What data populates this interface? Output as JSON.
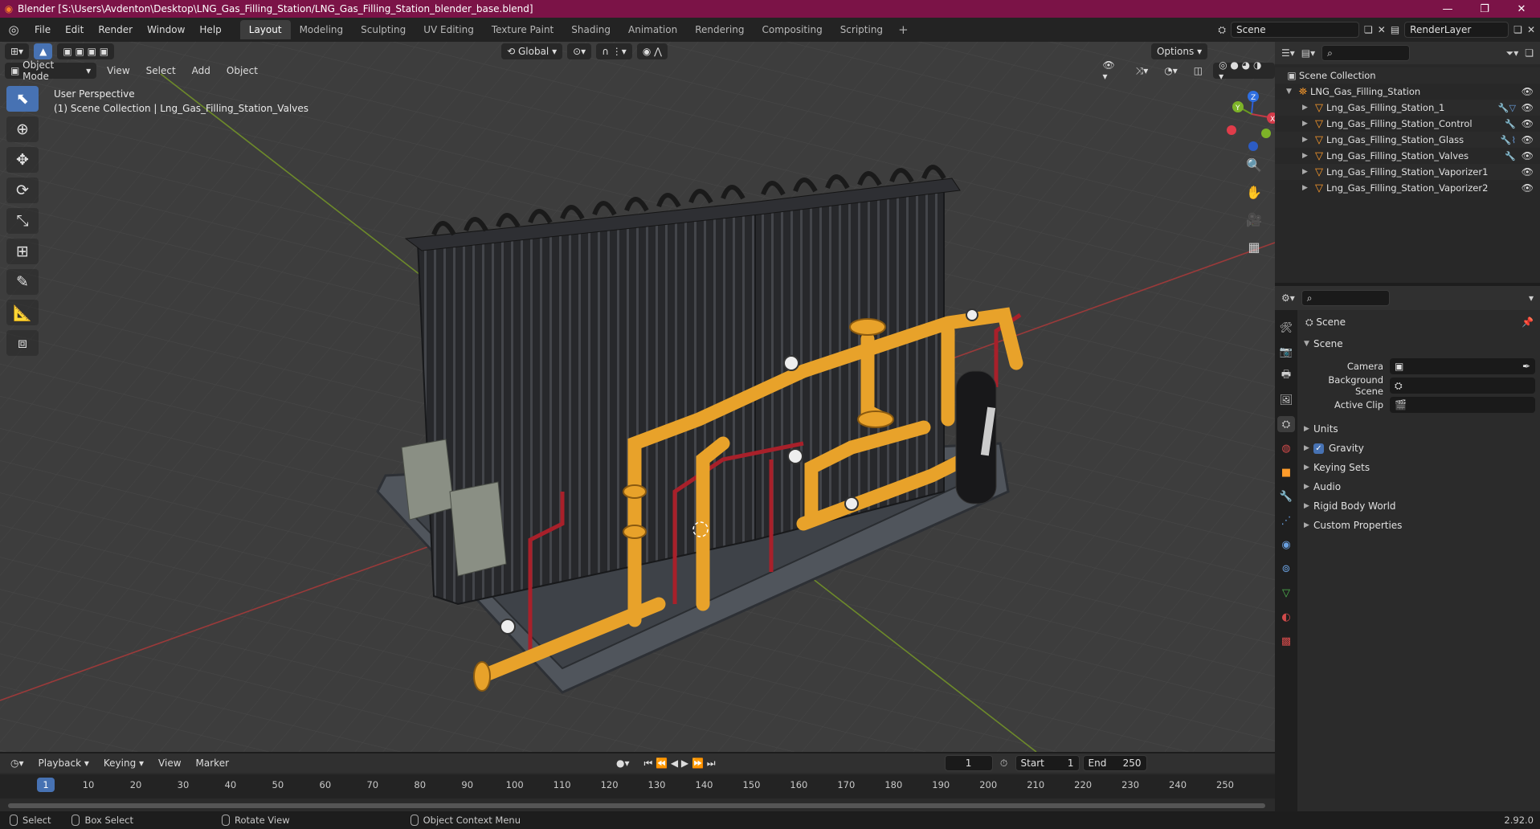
{
  "app": {
    "title": "Blender [S:\\Users\\Avdenton\\Desktop\\LNG_Gas_Filling_Station/LNG_Gas_Filling_Station_blender_base.blend]",
    "version": "2.92.0"
  },
  "menubar": {
    "items": [
      "File",
      "Edit",
      "Render",
      "Window",
      "Help"
    ],
    "workspaces": [
      "Layout",
      "Modeling",
      "Sculpting",
      "UV Editing",
      "Texture Paint",
      "Shading",
      "Animation",
      "Rendering",
      "Compositing",
      "Scripting"
    ],
    "active_workspace": "Layout",
    "scene": "Scene",
    "view_layer": "RenderLayer"
  },
  "viewport": {
    "mode": "Object Mode",
    "menus": [
      "View",
      "Select",
      "Add",
      "Object"
    ],
    "transform_orientation": "Global",
    "options_label": "Options",
    "info_line1": "User Perspective",
    "info_line2": "(1) Scene Collection | Lng_Gas_Filling_Station_Valves",
    "gizmo_axes": [
      "X",
      "Y",
      "Z"
    ]
  },
  "outliner": {
    "root": "Scene Collection",
    "collection": "LNG_Gas_Filling_Station",
    "objects": [
      "Lng_Gas_Filling_Station_1",
      "Lng_Gas_Filling_Station_Control",
      "Lng_Gas_Filling_Station_Glass",
      "Lng_Gas_Filling_Station_Valves",
      "Lng_Gas_Filling_Station_Vaporizer1",
      "Lng_Gas_Filling_Station_Vaporizer2"
    ]
  },
  "properties": {
    "context": "Scene",
    "panel_title": "Scene",
    "fields": [
      {
        "label": "Camera",
        "value": ""
      },
      {
        "label": "Background Scene",
        "value": ""
      },
      {
        "label": "Active Clip",
        "value": ""
      }
    ],
    "sections": [
      "Units",
      "Gravity",
      "Keying Sets",
      "Audio",
      "Rigid Body World",
      "Custom Properties"
    ]
  },
  "timeline": {
    "menus": [
      "Playback",
      "Keying",
      "View",
      "Marker"
    ],
    "current_frame": "1",
    "start_label": "Start",
    "start": "1",
    "end_label": "End",
    "end": "250",
    "ruler": [
      "1",
      "10",
      "20",
      "30",
      "40",
      "50",
      "60",
      "70",
      "80",
      "90",
      "100",
      "110",
      "120",
      "130",
      "140",
      "150",
      "160",
      "170",
      "180",
      "190",
      "200",
      "210",
      "220",
      "230",
      "240",
      "250"
    ]
  },
  "statusbar": {
    "select": "Select",
    "box_select": "Box Select",
    "rotate_view": "Rotate View",
    "context_menu": "Object Context Menu"
  }
}
